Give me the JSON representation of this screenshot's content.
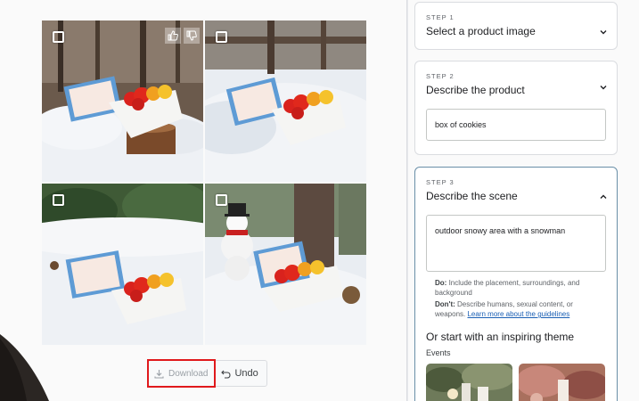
{
  "image_grid": {
    "tiles": [
      {
        "selected": false,
        "has_feedback": true
      },
      {
        "selected": false,
        "has_feedback": false
      },
      {
        "selected": false,
        "has_feedback": false
      },
      {
        "selected": false,
        "has_feedback": false
      }
    ]
  },
  "actions": {
    "download_label": "Download",
    "undo_label": "Undo"
  },
  "steps": [
    {
      "label": "STEP 1",
      "title": "Select a product image",
      "expanded": false
    },
    {
      "label": "STEP 2",
      "title": "Describe the product",
      "expanded": true,
      "input_value": "box of cookies"
    },
    {
      "label": "STEP 3",
      "title": "Describe the scene",
      "expanded": true,
      "input_value": "outdoor snowy area with a snowman"
    }
  ],
  "guidelines": {
    "do_label": "Do:",
    "do_text": "Include the placement, surroundings, and background",
    "dont_label": "Don't:",
    "dont_text": "Describe humans, sexual content, or weapons.",
    "link_text": "Learn more about the guidelines"
  },
  "themes": {
    "title": "Or start with an inspiring theme",
    "category": "Events"
  },
  "colors": {
    "highlight_border": "#e0191c",
    "link": "#1a5fb4",
    "active_step_border": "#6a8fa8"
  }
}
